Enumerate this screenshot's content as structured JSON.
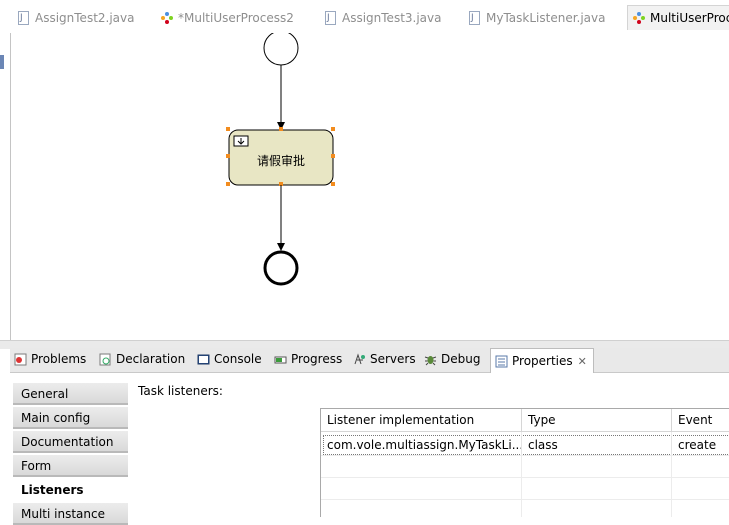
{
  "editor_tabs": [
    {
      "label": "AssignTest2.java",
      "icon": "java-file-icon"
    },
    {
      "label": "*MultiUserProcess2",
      "icon": "bpmn-file-icon"
    },
    {
      "label": "AssignTest3.java",
      "icon": "java-file-icon"
    },
    {
      "label": "MyTaskListener.java",
      "icon": "java-file-icon"
    },
    {
      "label": "MultiUserProc",
      "icon": "bpmn-file-icon"
    }
  ],
  "diagram": {
    "user_task_label": "请假审批",
    "colors": {
      "task_fill": "#e8e6c4",
      "task_border": "#000000",
      "handle": "#f28c1e"
    }
  },
  "view_tabs": [
    {
      "label": "Problems",
      "icon": "problems-icon"
    },
    {
      "label": "Declaration",
      "icon": "declaration-icon"
    },
    {
      "label": "Console",
      "icon": "console-icon"
    },
    {
      "label": "Progress",
      "icon": "progress-icon"
    },
    {
      "label": "Servers",
      "icon": "servers-icon"
    },
    {
      "label": "Debug",
      "icon": "debug-icon"
    },
    {
      "label": "Properties",
      "icon": "properties-icon",
      "close": "✕"
    }
  ],
  "properties": {
    "sections": [
      "General",
      "Main config",
      "Documentation",
      "Form",
      "Listeners",
      "Multi instance"
    ],
    "selected_section": "Listeners",
    "task_listeners_label": "Task listeners:",
    "table": {
      "columns": [
        "Listener implementation",
        "Type",
        "Event"
      ],
      "rows": [
        [
          "com.vole.multiassign.MyTaskLi...",
          "class",
          "create"
        ]
      ]
    }
  }
}
